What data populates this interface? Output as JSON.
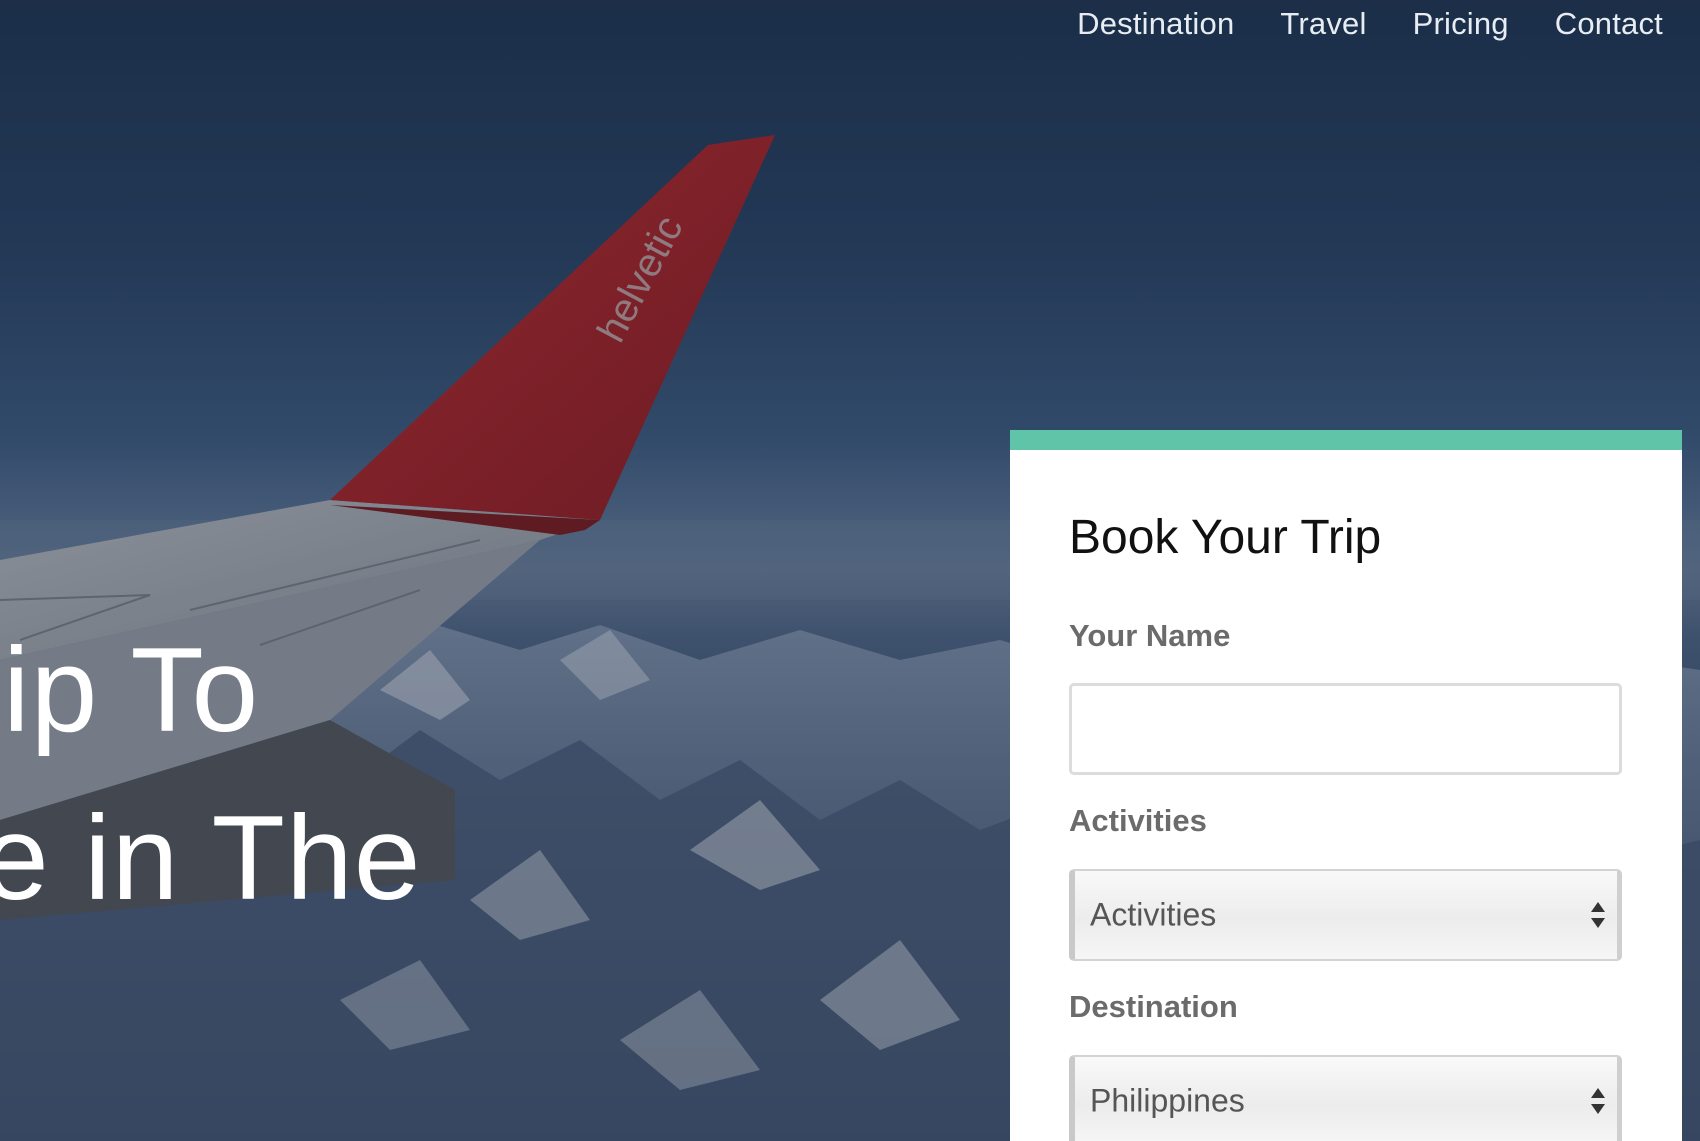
{
  "nav": {
    "items": [
      {
        "label": "Destination"
      },
      {
        "label": "Travel"
      },
      {
        "label": "Pricing"
      },
      {
        "label": "Contact"
      }
    ]
  },
  "hero": {
    "line1": "rip To",
    "line2": "e in The"
  },
  "booking": {
    "title": "Book Your Trip",
    "accent_color": "#5fc4a8",
    "name_label": "Your Name",
    "name_value": "",
    "activities_label": "Activities",
    "activities_selected": "Activities",
    "destination_label": "Destination",
    "destination_selected": "Philippines"
  },
  "background": {
    "wingtip_text": "helvetic",
    "wing_color": "#b3262b"
  }
}
